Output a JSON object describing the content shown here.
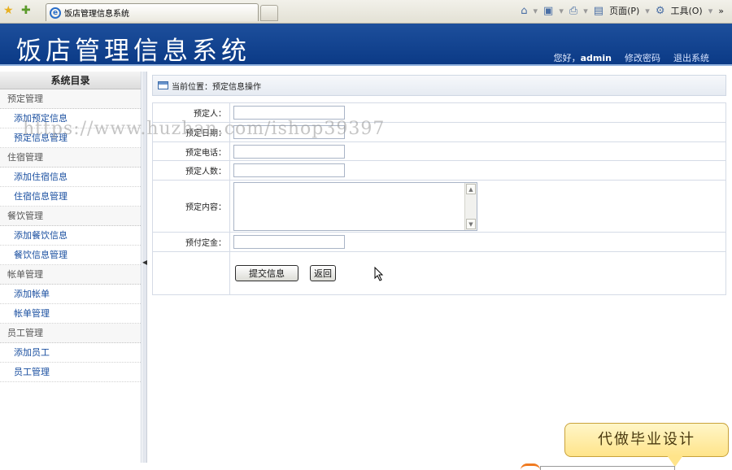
{
  "browser": {
    "tab_title": "饭店管理信息系统",
    "tools": {
      "page_label": "页面(P)",
      "tools_label": "工具(O)",
      "overflow": "»"
    }
  },
  "header": {
    "site_title": "饭店管理信息系统",
    "greeting": "您好，",
    "username": "admin",
    "change_password": "修改密码",
    "logout": "退出系统"
  },
  "sidebar": {
    "title": "系统目录",
    "groups": [
      {
        "label": "预定管理",
        "items": [
          "添加预定信息",
          "预定信息管理"
        ]
      },
      {
        "label": "住宿管理",
        "items": [
          "添加住宿信息",
          "住宿信息管理"
        ]
      },
      {
        "label": "餐饮管理",
        "items": [
          "添加餐饮信息",
          "餐饮信息管理"
        ]
      },
      {
        "label": "帐单管理",
        "items": [
          "添加帐单",
          "帐单管理"
        ]
      },
      {
        "label": "员工管理",
        "items": [
          "添加员工",
          "员工管理"
        ]
      }
    ]
  },
  "main": {
    "breadcrumb": "当前位置：预定信息操作",
    "form": {
      "booker_label": "预定人：",
      "booker_value": "",
      "date_label": "预定日期：",
      "date_value": "",
      "phone_label": "预定电话：",
      "phone_value": "",
      "count_label": "预定人数：",
      "count_value": "",
      "content_label": "预定内容：",
      "content_value": "",
      "deposit_label": "预付定金：",
      "deposit_value": ""
    },
    "buttons": {
      "submit": "提交信息",
      "back": "返回"
    }
  },
  "overlay": {
    "watermark": "https://www.huzhan.com/ishop39397",
    "promo": "代做毕业设计"
  },
  "colors": {
    "banner": "#0b3a86",
    "link": "#1a4fa0",
    "promo": "#ffe48a"
  }
}
